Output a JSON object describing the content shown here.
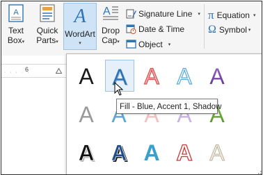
{
  "ribbon": {
    "text_box": {
      "line1": "Text",
      "line2": "Box",
      "caret": "▾"
    },
    "quick_parts": {
      "line1": "Quick",
      "line2": "Parts",
      "caret": "▾"
    },
    "wordart": {
      "label": "WordArt",
      "caret": "▾"
    },
    "drop_cap": {
      "line1": "Drop",
      "line2": "Cap",
      "caret": "▾"
    },
    "signature_line": {
      "label": "Signature Line",
      "caret": "▾"
    },
    "date_time": {
      "label": "Date & Time"
    },
    "object": {
      "label": "Object",
      "caret": "▾"
    },
    "equation": {
      "glyph": "π",
      "label": "Equation",
      "caret": "▾"
    },
    "symbol": {
      "glyph": "Ω",
      "label": "Symbol",
      "caret": "▾"
    }
  },
  "ruler": {
    "dots": "· · · · ·",
    "number": "6"
  },
  "gallery": {
    "letter": "A",
    "styles": [
      {
        "name": "black-plain",
        "fill": "#1a1a1a",
        "stroke": "none"
      },
      {
        "name": "blue-accent1-shadow",
        "fill": "#2f74b5",
        "stroke": "none"
      },
      {
        "name": "red-outline-fill",
        "fill": "#f4b6b6",
        "stroke": "#d45353"
      },
      {
        "name": "blue-outline",
        "fill": "#ffffff",
        "stroke": "#5aa6d6"
      },
      {
        "name": "purple-gradient",
        "fill": "#7a4aa8",
        "stroke": "none"
      },
      {
        "name": "gray-plain",
        "fill": "#9a9a9a",
        "stroke": "none"
      },
      {
        "name": "hidden-1",
        "fill": "#f2c0c0",
        "stroke": "none"
      },
      {
        "name": "hidden-2",
        "fill": "#c9b3e0",
        "stroke": "none"
      },
      {
        "name": "hidden-3",
        "fill": "#a8d4ea",
        "stroke": "none"
      },
      {
        "name": "green-gradient",
        "fill": "#6aa832",
        "stroke": "none"
      },
      {
        "name": "black-bold-shadow",
        "fill": "#111111",
        "stroke": "#ffffff"
      },
      {
        "name": "blue-bold",
        "fill": "#1f4f86",
        "stroke": "#ffffff"
      },
      {
        "name": "teal-bold",
        "fill": "#3aa0c8",
        "stroke": "none"
      },
      {
        "name": "red-outline-bold",
        "fill": "#ffffff",
        "stroke": "#c83a3a"
      },
      {
        "name": "cream-outline",
        "fill": "#f3efe4",
        "stroke": "#b8b09a"
      }
    ]
  },
  "tooltip": {
    "text": "Fill - Blue, Accent 1, Shadow"
  }
}
